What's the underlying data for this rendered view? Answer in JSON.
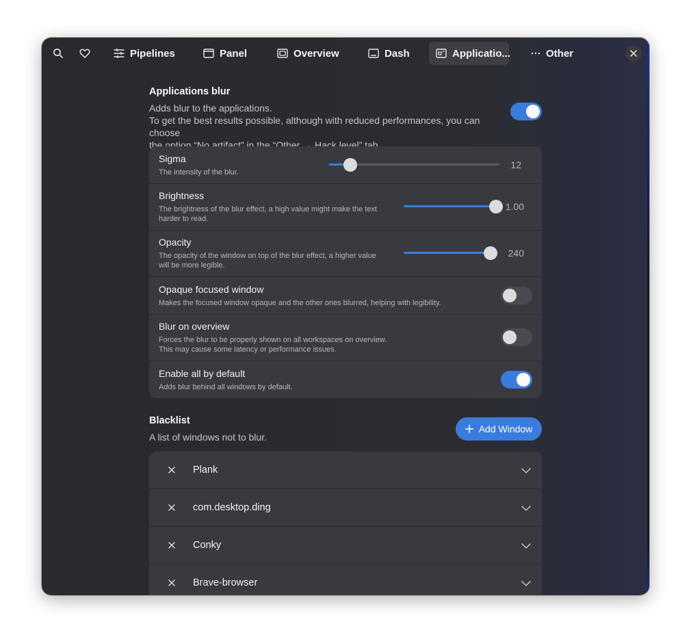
{
  "header": {
    "search_icon": "search-icon",
    "favorite_icon": "heart-icon",
    "tabs": [
      {
        "label": "Pipelines",
        "icon": "sliders-icon",
        "active": false
      },
      {
        "label": "Panel",
        "icon": "panel-icon",
        "active": false
      },
      {
        "label": "Overview",
        "icon": "overview-icon",
        "active": false
      },
      {
        "label": "Dash",
        "icon": "dash-icon",
        "active": false
      },
      {
        "label": "Applicatio...",
        "icon": "applications-icon",
        "active": true
      },
      {
        "label": "Other",
        "icon": "more-icon",
        "active": false
      }
    ],
    "close_icon": "close-icon"
  },
  "applications_blur": {
    "title": "Applications blur",
    "description_line1": "Adds blur to the applications.",
    "description_line2": "To get the best results possible, although with reduced performances, you can choose",
    "description_line3": "the option “No artifact” in the “Other → Hack level” tab.",
    "enabled": true,
    "sigma": {
      "title": "Sigma",
      "subtitle": "The intensity of the blur.",
      "value": "12",
      "fraction": 0.125
    },
    "brightness": {
      "title": "Brightness",
      "subtitle_line1": "The brightness of the blur effect, a high value might make the text",
      "subtitle_line2": "harder to read.",
      "value": "1.00",
      "fraction": 1.0
    },
    "opacity": {
      "title": "Opacity",
      "subtitle_line1": "The opacity of the window on top of the blur effect, a higher value",
      "subtitle_line2": "will be more legible.",
      "value": "240",
      "fraction": 0.94
    },
    "opaque_focused": {
      "title": "Opaque focused window",
      "subtitle": "Makes the focused window opaque and the other ones blurred, helping with legibility.",
      "enabled": false
    },
    "blur_on_overview": {
      "title": "Blur on overview",
      "subtitle_line1": "Forces the blur to be properly shown on all workspaces on overview.",
      "subtitle_line2": "This may cause some latency or performance issues.",
      "enabled": false
    },
    "enable_all": {
      "title": "Enable all by default",
      "subtitle": "Adds blur behind all windows by default.",
      "enabled": true
    }
  },
  "blacklist": {
    "title": "Blacklist",
    "description": "A list of windows not to blur.",
    "add_label": "Add Window",
    "items": [
      {
        "name": "Plank"
      },
      {
        "name": "com.desktop.ding"
      },
      {
        "name": "Conky"
      },
      {
        "name": "Brave-browser"
      }
    ]
  },
  "colors": {
    "accent": "#3a7cdc",
    "window_bg": "#2c2c30",
    "card_bg": "#393940"
  }
}
